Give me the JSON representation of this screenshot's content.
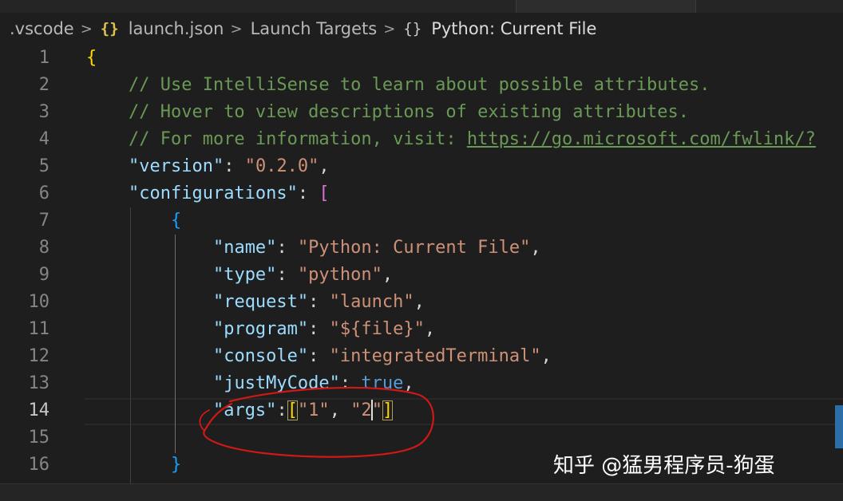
{
  "breadcrumb": {
    "items": [
      {
        "label": ".vscode",
        "icon": ""
      },
      {
        "label": "launch.json",
        "icon": "{}"
      },
      {
        "label": "Launch Targets",
        "icon": ""
      },
      {
        "label": "Python: Current File",
        "icon": "{}"
      }
    ],
    "separator": ">"
  },
  "editor": {
    "current_line": 14,
    "lines": [
      {
        "n": "1",
        "t": [
          "{"
        ]
      },
      {
        "n": "2",
        "t": [
          "    ",
          "// Use IntelliSense to learn about possible attributes."
        ]
      },
      {
        "n": "3",
        "t": [
          "    ",
          "// Hover to view descriptions of existing attributes."
        ]
      },
      {
        "n": "4",
        "t": [
          "    ",
          "// For more information, visit: ",
          "https://go.microsoft.com/fwlink/?"
        ]
      },
      {
        "n": "5",
        "t": [
          "    ",
          "\"version\"",
          ": ",
          "\"0.2.0\"",
          ","
        ]
      },
      {
        "n": "6",
        "t": [
          "    ",
          "\"configurations\"",
          ": ",
          "["
        ]
      },
      {
        "n": "7",
        "t": [
          "        ",
          "{"
        ]
      },
      {
        "n": "8",
        "t": [
          "            ",
          "\"name\"",
          ": ",
          "\"Python: Current File\"",
          ","
        ]
      },
      {
        "n": "9",
        "t": [
          "            ",
          "\"type\"",
          ": ",
          "\"python\"",
          ","
        ]
      },
      {
        "n": "10",
        "t": [
          "            ",
          "\"request\"",
          ": ",
          "\"launch\"",
          ","
        ]
      },
      {
        "n": "11",
        "t": [
          "            ",
          "\"program\"",
          ": ",
          "\"${file}\"",
          ","
        ]
      },
      {
        "n": "12",
        "t": [
          "            ",
          "\"console\"",
          ": ",
          "\"integratedTerminal\"",
          ","
        ]
      },
      {
        "n": "13",
        "t": [
          "            ",
          "\"justMyCode\"",
          ": ",
          "true",
          ","
        ]
      },
      {
        "n": "14",
        "t": [
          "            ",
          "\"args\"",
          ":",
          "[",
          "\"1\"",
          ", ",
          "\"2",
          "\"",
          "]"
        ]
      },
      {
        "n": "15",
        "t": [
          ""
        ]
      },
      {
        "n": "16",
        "t": [
          "        ",
          "}"
        ]
      }
    ]
  },
  "colors": {
    "background": "#1e1e1e",
    "comment": "#6a9955",
    "key": "#9cdcfe",
    "string": "#ce9178",
    "boolean": "#569cd6",
    "annotation": "#d01818"
  },
  "watermark": "知乎 @猛男程序员-狗蛋"
}
